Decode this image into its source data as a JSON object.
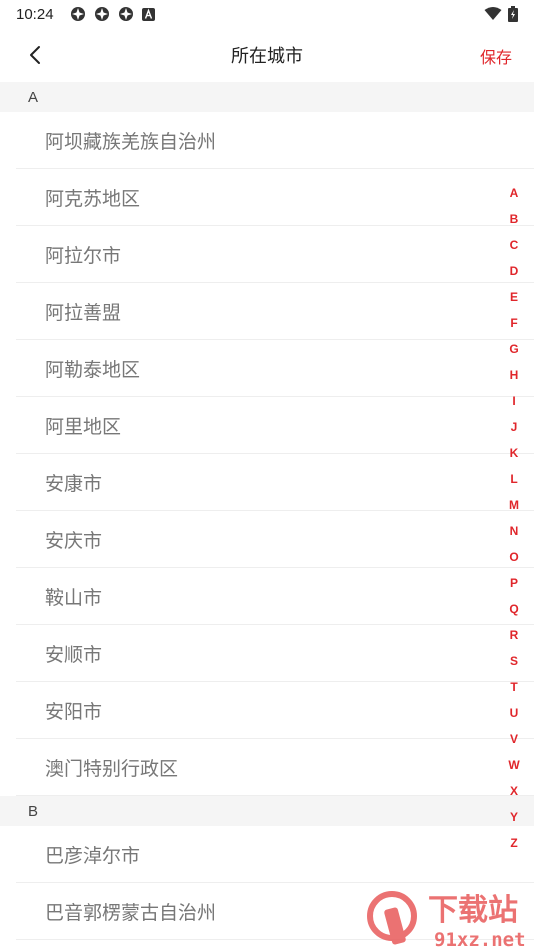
{
  "status": {
    "time": "10:24"
  },
  "nav": {
    "title": "所在城市",
    "save_label": "保存"
  },
  "sections": [
    {
      "letter": "A",
      "cities": [
        "阿坝藏族羌族自治州",
        "阿克苏地区",
        "阿拉尔市",
        "阿拉善盟",
        "阿勒泰地区",
        "阿里地区",
        "安康市",
        "安庆市",
        "鞍山市",
        "安顺市",
        "安阳市",
        "澳门特别行政区"
      ]
    },
    {
      "letter": "B",
      "cities": [
        "巴彦淖尔市",
        "巴音郭楞蒙古自治州"
      ]
    }
  ],
  "index_letters": [
    "A",
    "B",
    "C",
    "D",
    "E",
    "F",
    "G",
    "H",
    "I",
    "J",
    "K",
    "L",
    "M",
    "N",
    "O",
    "P",
    "Q",
    "R",
    "S",
    "T",
    "U",
    "V",
    "W",
    "X",
    "Y",
    "Z"
  ],
  "watermark": {
    "text": "下载站",
    "domain": "91xz.net"
  },
  "colors": {
    "accent": "#e0262b",
    "city_text": "#777777",
    "section_bg": "#f5f5f5"
  }
}
